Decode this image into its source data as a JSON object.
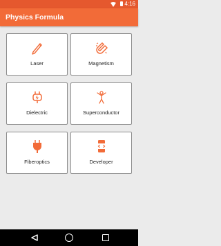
{
  "status_bar": {
    "time": "4:16"
  },
  "app_bar": {
    "title": "Physics Formula"
  },
  "cards": [
    {
      "label": "Laser",
      "icon": "pen-icon"
    },
    {
      "label": "Magnetism",
      "icon": "magnet-icon"
    },
    {
      "label": "Dielectric",
      "icon": "plug-icon"
    },
    {
      "label": "Superconductor",
      "icon": "person-icon"
    },
    {
      "label": "Fiberoptics",
      "icon": "plug-icon"
    },
    {
      "label": "Developer",
      "icon": "developer-icon"
    }
  ],
  "colors": {
    "accent": "#f26b38",
    "status_bar": "#e5582e",
    "background": "#ebebeb"
  }
}
